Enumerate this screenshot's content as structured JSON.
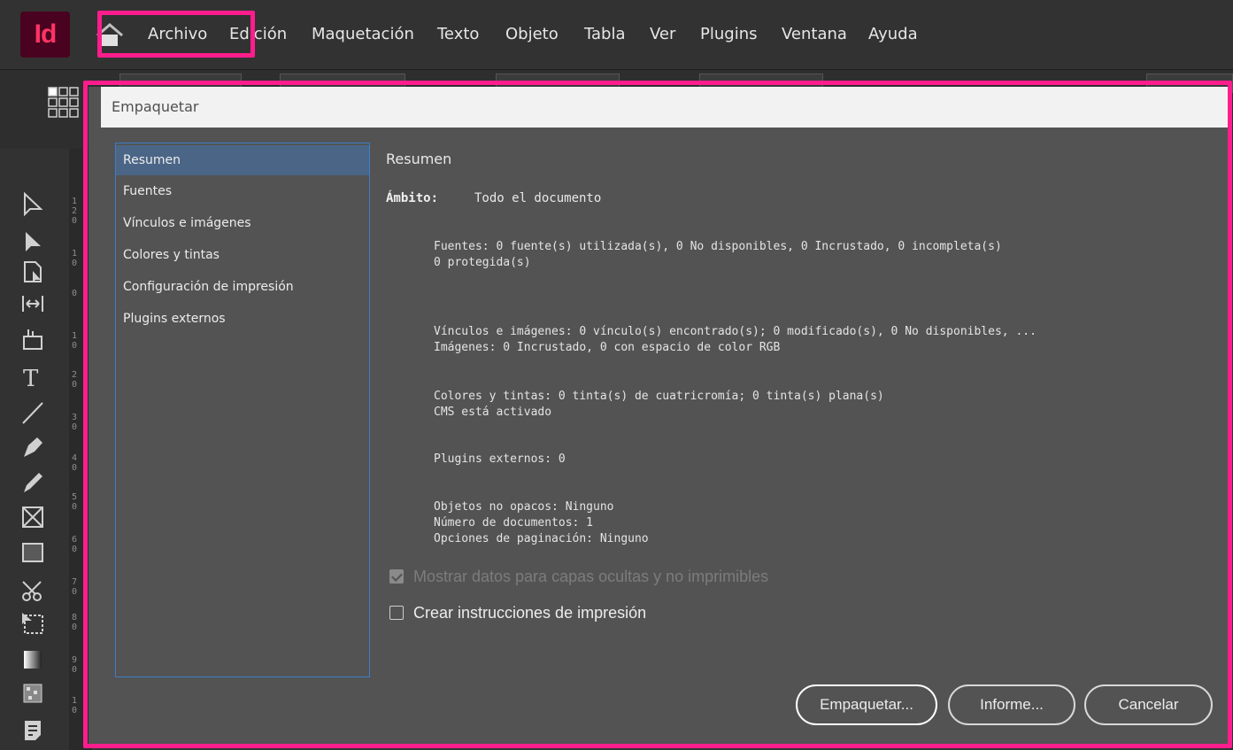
{
  "app": {
    "logo_text": "Id",
    "logo_color": "#49021f",
    "logo_text_color": "#ff3366"
  },
  "menu": {
    "items": [
      "Archivo",
      "Edición",
      "Maquetación",
      "Texto",
      "Objeto",
      "Tabla",
      "Ver",
      "Plugins",
      "Ventana",
      "Ayuda"
    ]
  },
  "highlight_color": "#ff1d8d",
  "ruler": {
    "numbers": [
      "1\n2\n0",
      "1\n0",
      "0",
      "1\n0",
      "2\n0",
      "3\n0",
      "4\n0",
      "5\n0",
      "6\n0",
      "7\n0",
      "8\n0",
      "9\n0",
      "1\n0"
    ]
  },
  "dialog": {
    "title": "Empaquetar",
    "nav": [
      "Resumen",
      "Fuentes",
      "Vínculos e imágenes",
      "Colores y tintas",
      "Configuración de impresión",
      "Plugins externos"
    ],
    "selected_nav": "Resumen",
    "section_title": "Resumen",
    "scope_label": "Ámbito:",
    "scope_value": "Todo el documento",
    "info": {
      "fonts_line1": "Fuentes: 0 fuente(s) utilizada(s), 0 No disponibles, 0 Incrustado, 0 incompleta(s)",
      "fonts_line2": "0 protegida(s)",
      "links_line1": "Vínculos e imágenes: 0 vínculo(s) encontrado(s); 0 modificado(s), 0 No disponibles, ...",
      "links_line2": "Imágenes: 0 Incrustado, 0 con espacio de color RGB",
      "colors_line1": "Colores y tintas: 0 tinta(s) de cuatricromía; 0 tinta(s) plana(s)",
      "colors_line2": "CMS está activado",
      "plugins_line": "Plugins externos: 0",
      "objects_line1": "Objetos no opacos: Ninguno",
      "objects_line2": "Número de documentos: 1",
      "objects_line3": "Opciones de paginación: Ninguno"
    },
    "checkboxes": {
      "show_hidden": {
        "label": "Mostrar datos para capas ocultas y no imprimibles",
        "checked": true,
        "disabled": true
      },
      "print_instructions": {
        "label": "Crear instrucciones de impresión",
        "checked": false,
        "disabled": false
      }
    },
    "buttons": {
      "package": "Empaquetar...",
      "report": "Informe...",
      "cancel": "Cancelar"
    }
  }
}
